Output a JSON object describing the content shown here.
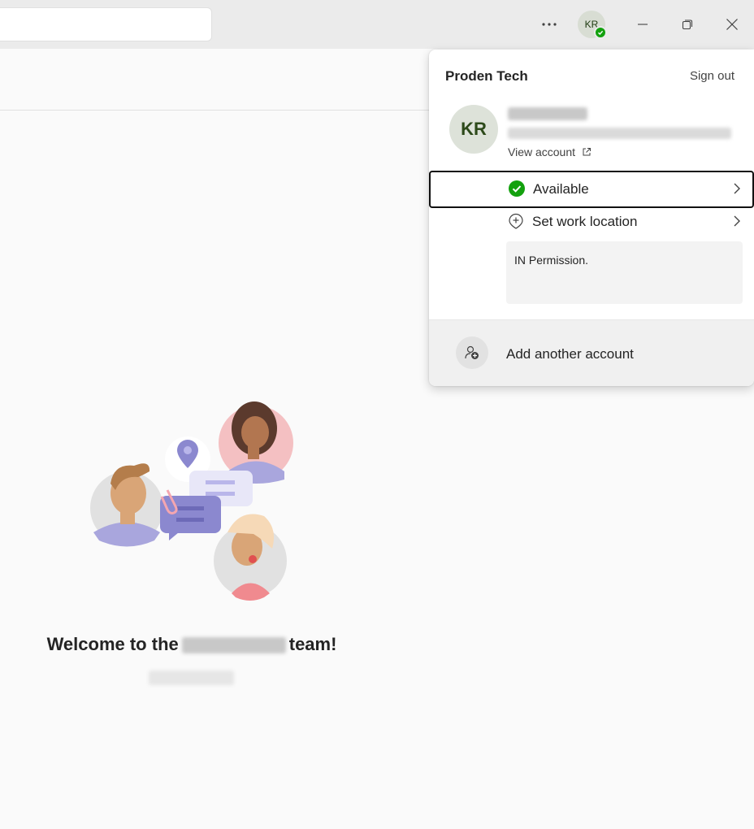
{
  "titlebar": {
    "search_placeholder": "",
    "more_label": "···",
    "avatar_initials": "KR"
  },
  "welcome": {
    "prefix": "Welcome to the",
    "suffix": "team!"
  },
  "flyout": {
    "org_name": "Proden Tech",
    "sign_out_label": "Sign out",
    "avatar_initials": "KR",
    "view_account_label": "View account",
    "status_label": "Available",
    "work_location_label": "Set work location",
    "status_message": "IN Permission.",
    "add_account_label": "Add another account"
  },
  "colors": {
    "available_green": "#13a10e",
    "avatar_bg": "#dde2d9"
  }
}
